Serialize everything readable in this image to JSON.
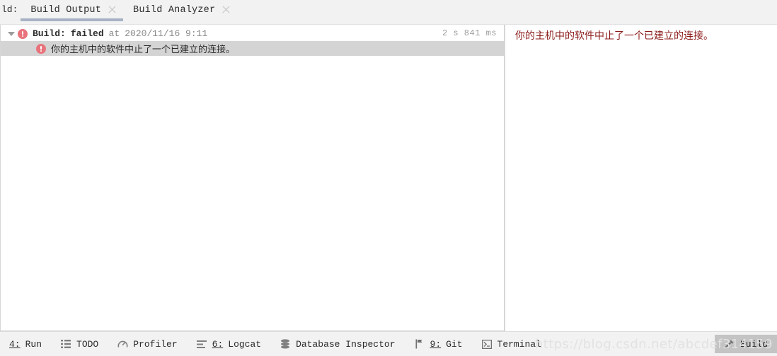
{
  "window": {
    "clipped_label": "ld:"
  },
  "tabs": [
    {
      "label": "Build Output",
      "active": true,
      "close_icon": "close-icon"
    },
    {
      "label": "Build Analyzer",
      "active": false,
      "close_icon": "close-icon"
    }
  ],
  "build_tree": {
    "root": {
      "twisty_icon": "chevron-down-icon",
      "status_icon": "error-icon",
      "title": "Build:",
      "status": "failed",
      "at_label": "at",
      "timestamp": "2020/11/16 9:11",
      "duration": "2 s 841 ms"
    },
    "children": [
      {
        "status_icon": "error-icon",
        "message": "你的主机中的软件中止了一个已建立的连接。",
        "selected": true
      }
    ]
  },
  "detail_pane": {
    "message": "你的主机中的软件中止了一个已建立的连接。",
    "text_color": "#8b1a1a"
  },
  "statusbar": {
    "items": [
      {
        "number": "4:",
        "label": "Run",
        "icon": "",
        "selected": false
      },
      {
        "number": "",
        "label": "TODO",
        "icon": "list-icon",
        "selected": false
      },
      {
        "number": "",
        "label": "Profiler",
        "icon": "gauge-icon",
        "selected": false
      },
      {
        "number": "6:",
        "label": "Logcat",
        "icon": "lines-icon",
        "selected": false
      },
      {
        "number": "",
        "label": "Database Inspector",
        "icon": "database-icon",
        "selected": false
      },
      {
        "number": "9:",
        "label": "Git",
        "icon": "branch-icon",
        "selected": false
      },
      {
        "number": "",
        "label": "Terminal",
        "icon": "terminal-icon",
        "selected": false
      },
      {
        "number": "",
        "label": "Build",
        "icon": "hammer-icon",
        "selected": true
      }
    ]
  },
  "watermark": {
    "text": "https://blog.csdn.net/abcdef314159"
  },
  "colors": {
    "error": "#e8737c",
    "selection": "#d4d4d4",
    "tab_underline": "#a7b2c4",
    "statusbar_selected": "#c4c4c4"
  }
}
